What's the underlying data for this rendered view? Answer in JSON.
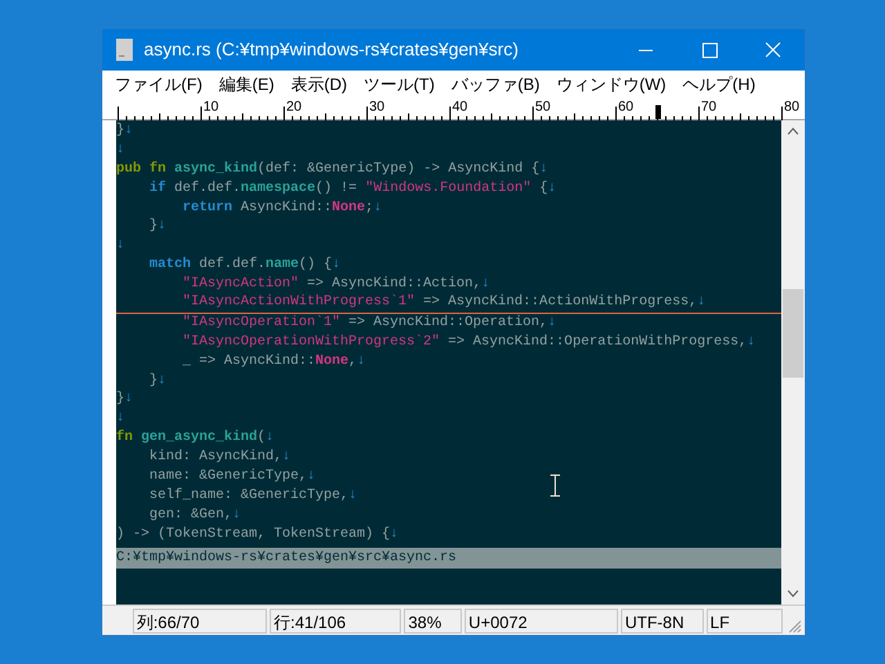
{
  "window": {
    "title": "async.rs (C:¥tmp¥windows-rs¥crates¥gen¥src)"
  },
  "menu": [
    "ファイル(F)",
    "編集(E)",
    "表示(D)",
    "ツール(T)",
    "バッファ(B)",
    "ウィンドウ(W)",
    "ヘルプ(H)"
  ],
  "ruler": {
    "labels": [
      "10",
      "20",
      "30",
      "40",
      "50",
      "60",
      "70",
      "80"
    ],
    "level": 0.8125
  },
  "lines": [
    {
      "cursor": false,
      "tokens": [
        {
          "kind": "plain",
          "text": "}"
        },
        {
          "kind": "eol",
          "text": "↓"
        }
      ]
    },
    {
      "cursor": false,
      "tokens": [
        {
          "kind": "eol",
          "text": "↓"
        }
      ]
    },
    {
      "cursor": false,
      "tokens": [
        {
          "kind": "kw",
          "text": "pub "
        },
        {
          "kind": "kw",
          "text": "fn "
        },
        {
          "kind": "fn",
          "text": "async_kind"
        },
        {
          "kind": "plain",
          "text": "(def: &GenericType) -> AsyncKind {"
        },
        {
          "kind": "eol",
          "text": "↓"
        }
      ]
    },
    {
      "cursor": false,
      "tokens": [
        {
          "kind": "kw2",
          "text": "    if"
        },
        {
          "kind": "plain",
          "text": " def.def."
        },
        {
          "kind": "fn",
          "text": "namespace"
        },
        {
          "kind": "plain",
          "text": "() != "
        },
        {
          "kind": "str",
          "text": "\"Windows.Foundation\""
        },
        {
          "kind": "plain",
          "text": " {"
        },
        {
          "kind": "eol",
          "text": "↓"
        }
      ]
    },
    {
      "cursor": false,
      "tokens": [
        {
          "kind": "kw2",
          "text": "        return"
        },
        {
          "kind": "plain",
          "text": " AsyncKind::"
        },
        {
          "kind": "const",
          "text": "None"
        },
        {
          "kind": "plain",
          "text": ";"
        },
        {
          "kind": "eol",
          "text": "↓"
        }
      ]
    },
    {
      "cursor": false,
      "tokens": [
        {
          "kind": "plain",
          "text": "    }"
        },
        {
          "kind": "eol",
          "text": "↓"
        }
      ]
    },
    {
      "cursor": false,
      "tokens": [
        {
          "kind": "eol",
          "text": "↓"
        }
      ]
    },
    {
      "cursor": false,
      "tokens": [
        {
          "kind": "kw2",
          "text": "    match"
        },
        {
          "kind": "plain",
          "text": " def.def."
        },
        {
          "kind": "fn",
          "text": "name"
        },
        {
          "kind": "plain",
          "text": "() {"
        },
        {
          "kind": "eol",
          "text": "↓"
        }
      ]
    },
    {
      "cursor": false,
      "tokens": [
        {
          "kind": "str",
          "text": "        \"IAsyncAction\""
        },
        {
          "kind": "plain",
          "text": " => AsyncKind::Action,"
        },
        {
          "kind": "eol",
          "text": "↓"
        }
      ]
    },
    {
      "cursor": true,
      "tokens": [
        {
          "kind": "str",
          "text": "        \"IAsyncActionWithProgress`1\""
        },
        {
          "kind": "plain",
          "text": " => AsyncKind::ActionWithProgress,"
        },
        {
          "kind": "eol",
          "text": "↓"
        }
      ]
    },
    {
      "cursor": false,
      "tokens": [
        {
          "kind": "str",
          "text": "        \"IAsyncOperation`1\""
        },
        {
          "kind": "plain",
          "text": " => AsyncKind::Operation,"
        },
        {
          "kind": "eol",
          "text": "↓"
        }
      ]
    },
    {
      "cursor": false,
      "tokens": [
        {
          "kind": "str",
          "text": "        \"IAsyncOperationWithProgress`2\""
        },
        {
          "kind": "plain",
          "text": " => AsyncKind::OperationWithProgress,"
        },
        {
          "kind": "eol",
          "text": "↓"
        }
      ]
    },
    {
      "cursor": false,
      "tokens": [
        {
          "kind": "plain",
          "text": "        _ => AsyncKind::"
        },
        {
          "kind": "const",
          "text": "None"
        },
        {
          "kind": "plain",
          "text": ","
        },
        {
          "kind": "eol",
          "text": "↓"
        }
      ]
    },
    {
      "cursor": false,
      "tokens": [
        {
          "kind": "plain",
          "text": "    }"
        },
        {
          "kind": "eol",
          "text": "↓"
        }
      ]
    },
    {
      "cursor": false,
      "tokens": [
        {
          "kind": "plain",
          "text": "}"
        },
        {
          "kind": "eol",
          "text": "↓"
        }
      ]
    },
    {
      "cursor": false,
      "tokens": [
        {
          "kind": "eol",
          "text": "↓"
        }
      ]
    },
    {
      "cursor": false,
      "tokens": [
        {
          "kind": "kw",
          "text": "fn "
        },
        {
          "kind": "fn",
          "text": "gen_async_kind"
        },
        {
          "kind": "plain",
          "text": "("
        },
        {
          "kind": "eol",
          "text": "↓"
        }
      ]
    },
    {
      "cursor": false,
      "tokens": [
        {
          "kind": "plain",
          "text": "    kind: AsyncKind,"
        },
        {
          "kind": "eol",
          "text": "↓"
        }
      ]
    },
    {
      "cursor": false,
      "tokens": [
        {
          "kind": "plain",
          "text": "    name: &GenericType,"
        },
        {
          "kind": "eol",
          "text": "↓"
        }
      ]
    },
    {
      "cursor": false,
      "tokens": [
        {
          "kind": "plain",
          "text": "    self_name: &GenericType,"
        },
        {
          "kind": "eol",
          "text": "↓"
        }
      ]
    },
    {
      "cursor": false,
      "tokens": [
        {
          "kind": "plain",
          "text": "    gen: &Gen,"
        },
        {
          "kind": "eol",
          "text": "↓"
        }
      ]
    },
    {
      "cursor": false,
      "tokens": [
        {
          "kind": "plain",
          "text": ") -> (TokenStream, TokenStream) {"
        },
        {
          "kind": "eol",
          "text": "↓"
        }
      ]
    }
  ],
  "path_bar": "C:¥tmp¥windows-rs¥crates¥gen¥src¥async.rs",
  "status_bar": [
    "列:66/70",
    "行:41/106",
    "38%",
    "U+0072",
    "UTF-8N",
    "LF"
  ]
}
